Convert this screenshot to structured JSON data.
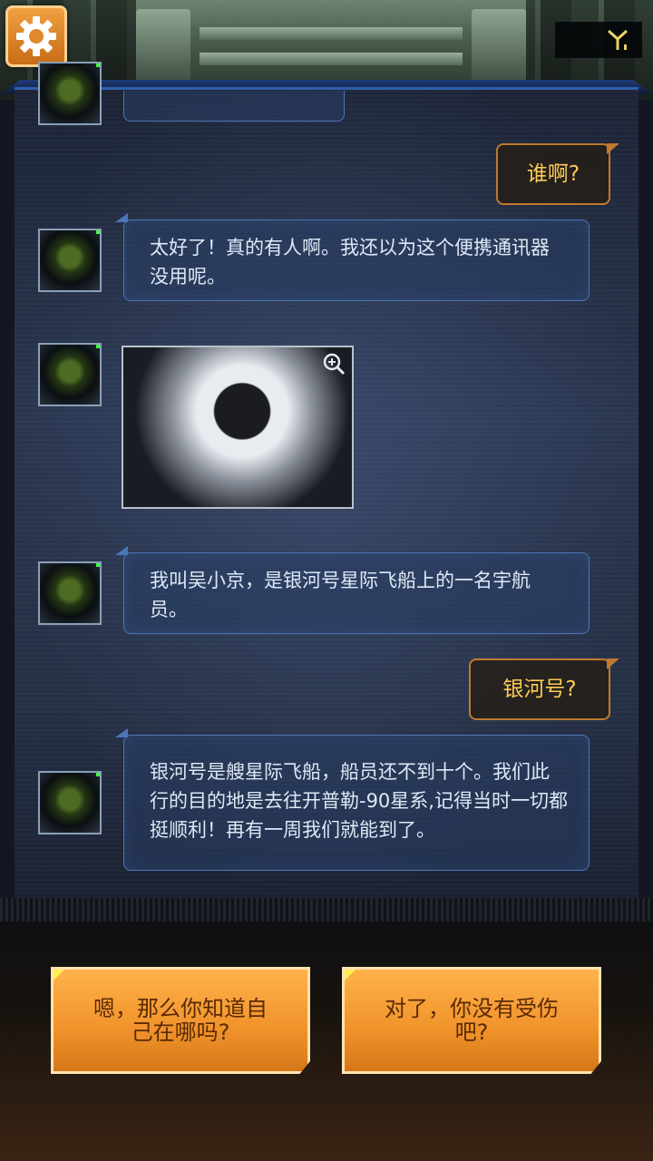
{
  "header": {
    "settings_icon": "gear-icon",
    "signal_icon": "antenna-signal-icon"
  },
  "messages": [
    {
      "side": "left",
      "type": "text",
      "text": "太好了！真的有人啊。我还以为这个便携通讯器没用呢。"
    },
    {
      "side": "right",
      "type": "text",
      "text": "谁啊?"
    },
    {
      "side": "left",
      "type": "image",
      "alt": "astronaut-photo",
      "icon": "zoom-in-icon"
    },
    {
      "side": "left",
      "type": "text",
      "text": "我叫吴小京，是银河号星际飞船上的一名宇航员。"
    },
    {
      "side": "right",
      "type": "text",
      "text": "银河号?"
    },
    {
      "side": "left",
      "type": "text",
      "text": "银河号是艘星际飞船，船员还不到十个。我们此行的目的地是去往开普勒-90星系,记得当时一切都挺顺利！再有一周我们就能到了。"
    }
  ],
  "bubbles": {
    "q1": "谁啊?",
    "m1_line1": "太好了！真的有人啊。我还以为这个便携通讯器",
    "m1_line2": "没用呢。",
    "m2_line1": "我叫吴小京，是银河号星际飞船上的一名宇航",
    "m2_line2": "员。",
    "q2": "银河号?",
    "m3_line1": "银河号是艘星际飞船，船员还不到十个。我们此",
    "m3_line2": "行的目的地是去往开普勒-90星系,记得当时一切都",
    "m3_line3": "挺顺利！再有一周我们就能到了。"
  },
  "choices": [
    {
      "line1": "嗯，那么你知道自",
      "line2": "己在哪吗?"
    },
    {
      "line1": "对了，你没有受伤",
      "line2": "吧?"
    }
  ],
  "colors": {
    "accent_orange": "#f0922a",
    "player_text": "#ffcc55",
    "npc_border": "#4c76b8"
  }
}
